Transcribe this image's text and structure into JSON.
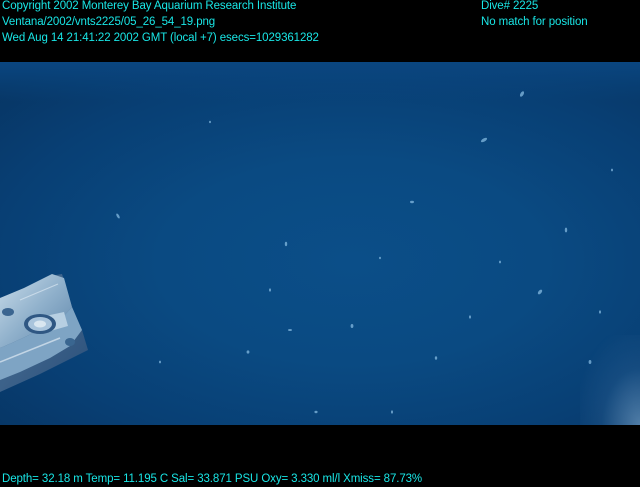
{
  "header": {
    "lines_left": [
      "Copyright 2002 Monterey Bay Aquarium Research Institute",
      "Ventana/2002/vnts2225/05_26_54_19.png",
      "Wed Aug 14 21:41:22 2002 GMT (local +7)  esecs=1029361282"
    ],
    "lines_right": [
      "Dive# 2225",
      "No match for position"
    ]
  },
  "footer": {
    "telemetry": "Depth= 32.18 m  Temp= 11.195 C  Sal= 33.871 PSU  Oxy= 3.330 ml/l  Xmiss= 87.73%"
  },
  "scene": {
    "water_color": "#0a4a82",
    "text_color": "#19e6e6",
    "subject": "robotic-arm-claw"
  }
}
